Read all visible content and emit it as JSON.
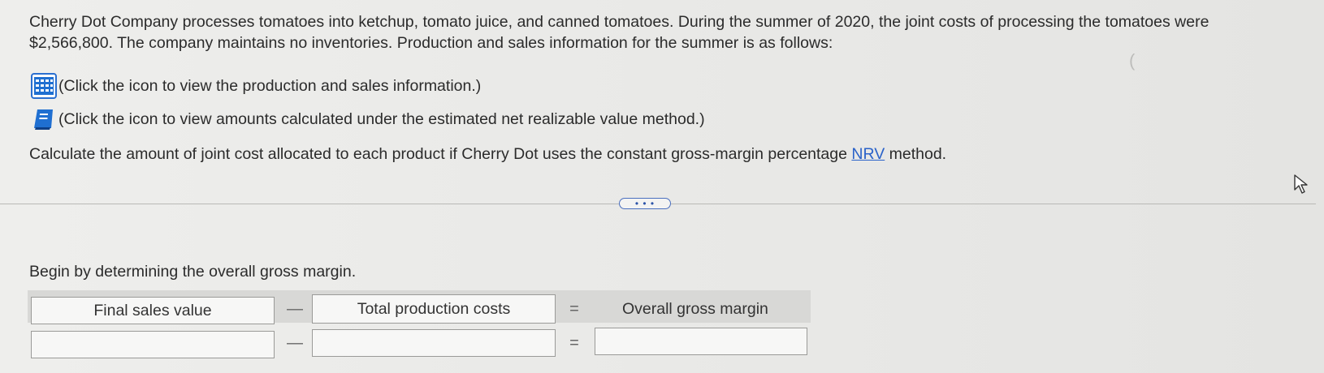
{
  "question": {
    "text": "Cherry Dot Company processes tomatoes into ketchup, tomato juice, and canned tomatoes. During the summer of 2020, the joint costs of processing the tomatoes were $2,566,800. The company maintains no inventories. Production and sales information for the summer is as follows:"
  },
  "info_links": [
    {
      "icon": "table-grid-icon",
      "text": "(Click the icon to view the production and sales information.)"
    },
    {
      "icon": "notebook-icon",
      "text": "(Click the icon to view amounts calculated under the estimated net realizable value method.)"
    }
  ],
  "instruction": {
    "before": "Calculate the amount of joint cost allocated to each product if Cherry Dot uses the constant gross-margin percentage ",
    "link": "NRV",
    "after": " method."
  },
  "more_button": {
    "label": "• • •"
  },
  "step": {
    "prompt": "Begin by determining the overall gross margin."
  },
  "equation": {
    "headers": {
      "col1": "Final sales value",
      "op1": "—",
      "col2": "Total production costs",
      "op2": "=",
      "col3": "Overall gross margin"
    },
    "row": {
      "final_sales_value": "",
      "total_production_costs": "",
      "overall_gross_margin": "",
      "op1": "—",
      "op2": "="
    }
  },
  "colors": {
    "link": "#2a62c9",
    "icon_blue": "#1f6fd1",
    "border": "#9a9a98"
  }
}
